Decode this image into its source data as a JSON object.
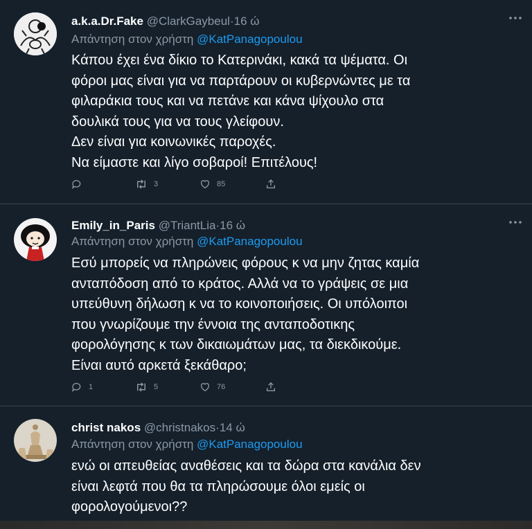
{
  "tweets": [
    {
      "name": "a.k.a.Dr.Fake",
      "handle": "@ClarkGaybeul",
      "separator": "·",
      "time": "16 ώ",
      "reply_prefix": "Απάντηση στον χρήστη",
      "reply_mention": "@KatPanagopoulou",
      "text": "Κάπου έχει ένα δίκιο το Κατερινάκι, κακά τα ψέματα. Οι\nφόροι μας είναι για να παρτάρουν οι κυβερνώντες με τα\nφιλαράκια τους και να πετάνε και κάνα ψίχουλο στα\nδουλικά τους για να τους γλείφουν.\nΔεν είναι για κοινωνικές παροχές.\nΝα είμαστε και λίγο σοβαροί! Επιτέλους!",
      "stats": {
        "replies": "",
        "retweets": "3",
        "likes": "85"
      }
    },
    {
      "name": "Emily_in_Paris",
      "handle": "@TriantLia",
      "separator": "·",
      "time": "16 ώ",
      "reply_prefix": "Απάντηση στον χρήστη",
      "reply_mention": "@KatPanagopoulou",
      "text": "Εσύ μπορείς να πληρώνεις φόρους κ να μην ζητας καμία\nανταπόδοση από το κράτος. Αλλά να το γράψεις σε μια\nυπεύθυνη δήλωση κ να το κοινοποιήσεις. Οι υπόλοιποι\nπου γνωρίζουμε την έννοια της ανταποδοτικης\nφορολόγησης κ των δικαιωμάτων μας, τα διεκδικούμε.\nΕίναι αυτό αρκετά ξεκάθαρο;",
      "stats": {
        "replies": "1",
        "retweets": "5",
        "likes": "76"
      }
    },
    {
      "name": "christ nakos",
      "handle": "@christnakos",
      "separator": "·",
      "time": "14 ώ",
      "reply_prefix": "Απάντηση στον χρήστη",
      "reply_mention": "@KatPanagopoulou",
      "text": "ενώ οι απευθείας αναθέσεις και τα δώρα στα κανάλια δεν\nείναι λεφτά που θα τα πληρώσουμε όλοι εμείς οι\nφορολογούμενοι??",
      "stats": {
        "replies": "",
        "retweets": "",
        "likes": ""
      }
    }
  ],
  "colors": {
    "background": "#15202b",
    "secondary_text": "#8b98a5",
    "mention": "#1d9bf0",
    "divider": "#38444d"
  },
  "icons": [
    "more-icon",
    "reply-icon",
    "retweet-icon",
    "like-icon",
    "share-icon"
  ]
}
